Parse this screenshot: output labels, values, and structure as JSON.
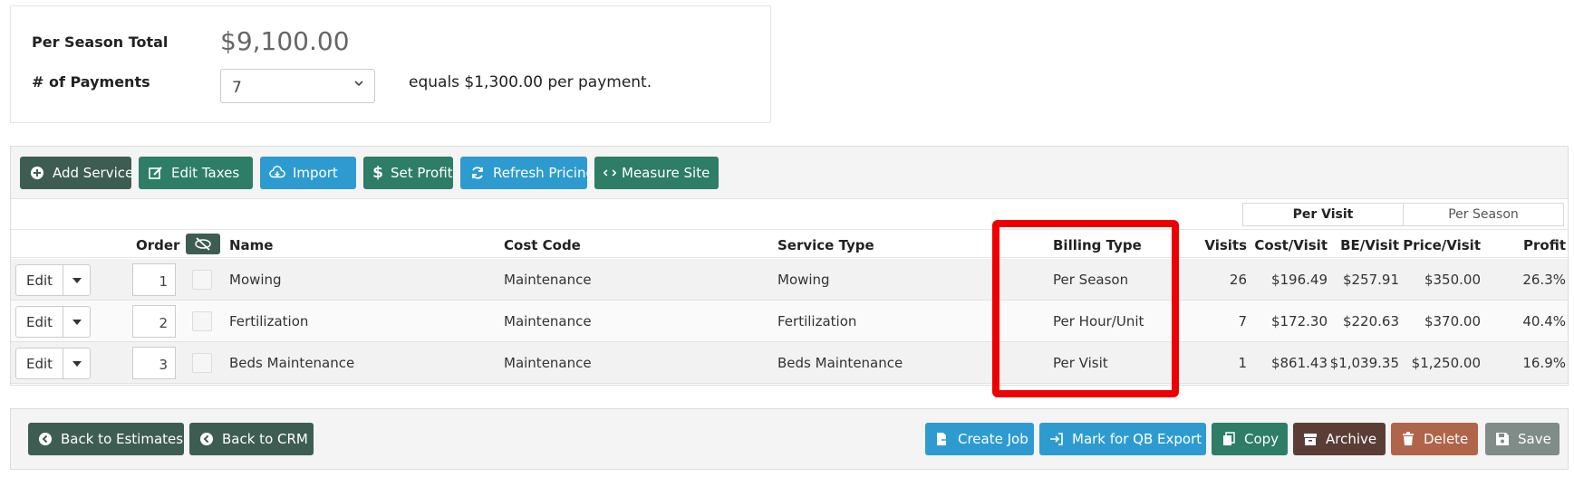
{
  "summary": {
    "per_season_total_label": "Per Season Total",
    "per_season_total_value": "$9,100.00",
    "payments_label": "# of Payments",
    "payments_selected": "7",
    "equals_text": "equals $1,300.00 per payment."
  },
  "toolbar": {
    "add_service": "Add Service",
    "edit_taxes": "Edit Taxes",
    "import": "Import",
    "set_profit": "Set Profit",
    "refresh_pricing": "Refresh Pricing",
    "measure_site": "Measure Site"
  },
  "view_toggle": {
    "per_visit": "Per Visit",
    "per_season": "Per Season",
    "active": "Per Visit"
  },
  "table": {
    "headers": {
      "order": "Order",
      "name": "Name",
      "cost_code": "Cost Code",
      "service_type": "Service Type",
      "billing_type": "Billing Type",
      "visits": "Visits",
      "cost_visit": "Cost/Visit",
      "be_visit": "BE/Visit",
      "price_visit": "Price/Visit",
      "profit": "Profit"
    },
    "edit_label": "Edit",
    "rows": [
      {
        "order": "1",
        "name": "Mowing",
        "cost_code": "Maintenance",
        "service_type": "Mowing",
        "billing_type": "Per Season",
        "visits": "26",
        "cost_visit": "$196.49",
        "be_visit": "$257.91",
        "price_visit": "$350.00",
        "profit": "26.3%"
      },
      {
        "order": "2",
        "name": "Fertilization",
        "cost_code": "Maintenance",
        "service_type": "Fertilization",
        "billing_type": "Per Hour/Unit",
        "visits": "7",
        "cost_visit": "$172.30",
        "be_visit": "$220.63",
        "price_visit": "$370.00",
        "profit": "40.4%"
      },
      {
        "order": "3",
        "name": "Beds Maintenance",
        "cost_code": "Maintenance",
        "service_type": "Beds Maintenance",
        "billing_type": "Per Visit",
        "visits": "1",
        "cost_visit": "$861.43",
        "be_visit": "$1,039.35",
        "price_visit": "$1,250.00",
        "profit": "16.9%"
      }
    ]
  },
  "footer": {
    "back_to_estimates": "Back to Estimates",
    "back_to_crm": "Back to CRM",
    "create_job": "Create Job",
    "mark_for_qb_export": "Mark for QB Export",
    "copy": "Copy",
    "archive": "Archive",
    "delete": "Delete",
    "save": "Save"
  },
  "colors": {
    "dark_green": "#3e5d52",
    "green": "#2e7d66",
    "blue": "#2e9bd0",
    "brown": "#5a3e35",
    "orange": "#b0644a",
    "gray": "#7f8c87",
    "highlight_red": "#ee0000"
  }
}
